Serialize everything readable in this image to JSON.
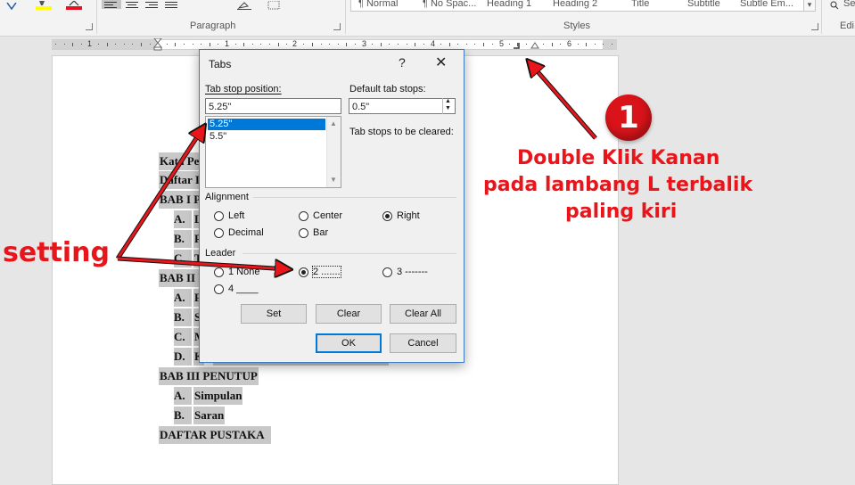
{
  "ribbon": {
    "paragraph_label": "Paragraph",
    "styles_label": "Styles",
    "editing_label": "Edi",
    "search_label": "Se",
    "styles": [
      "¶ Normal",
      "¶ No Spac...",
      "Heading 1",
      "Heading 2",
      "Title",
      "Subtitle",
      "Subtle Em..."
    ],
    "colors": {
      "highlight": "#ffff00",
      "font_color": "#e81123"
    }
  },
  "ruler": {
    "numbers": [
      "1",
      "1",
      "2",
      "3",
      "4",
      "5",
      "6"
    ]
  },
  "document": {
    "lines": [
      {
        "text": "Kata Pe",
        "kind": "heading"
      },
      {
        "text": "Daftar I",
        "kind": "heading"
      },
      {
        "text": "BAB I P",
        "kind": "heading"
      },
      {
        "letter": "A.",
        "text": "L"
      },
      {
        "letter": "B.",
        "text": "R"
      },
      {
        "letter": "C.",
        "text": "T"
      },
      {
        "text": "BAB II I",
        "kind": "heading"
      },
      {
        "letter": "A.",
        "text": "P"
      },
      {
        "letter": "B.",
        "text": "S"
      },
      {
        "letter": "C.",
        "text": "M"
      },
      {
        "letter": "D.",
        "text": "K"
      },
      {
        "text": "BAB III PENUTUP",
        "kind": "heading"
      },
      {
        "letter": "A.",
        "text": "Simpulan"
      },
      {
        "letter": "B.",
        "text": "Saran"
      },
      {
        "text": "DAFTAR PUSTAKA",
        "kind": "heading"
      }
    ]
  },
  "dialog": {
    "title": "Tabs",
    "help": "?",
    "close": "✕",
    "tab_stop_label": "Tab stop position:",
    "tab_stop_value": "5.25\"",
    "tab_stops": [
      "5.25\"",
      "5.5\""
    ],
    "default_label": "Default tab stops:",
    "default_value": "0.5\"",
    "cleared_label": "Tab stops to be cleared:",
    "alignment_label": "Alignment",
    "alignment_options": [
      "Left",
      "Center",
      "Right",
      "Decimal",
      "Bar"
    ],
    "alignment_selected": "Right",
    "leader_label": "Leader",
    "leader_options": [
      "1 None",
      "2 .......",
      "3 -------",
      "4 ____"
    ],
    "leader_selected": "2 .......",
    "buttons": {
      "set": "Set",
      "clear": "Clear",
      "clear_all": "Clear All",
      "ok": "OK",
      "cancel": "Cancel"
    }
  },
  "annotations": {
    "badge": "1",
    "instruction_line1": "Double Klik Kanan",
    "instruction_line2": "pada lambang L terbalik",
    "instruction_line3": "paling kiri",
    "setting": "setting",
    "color": "#e8151b"
  }
}
